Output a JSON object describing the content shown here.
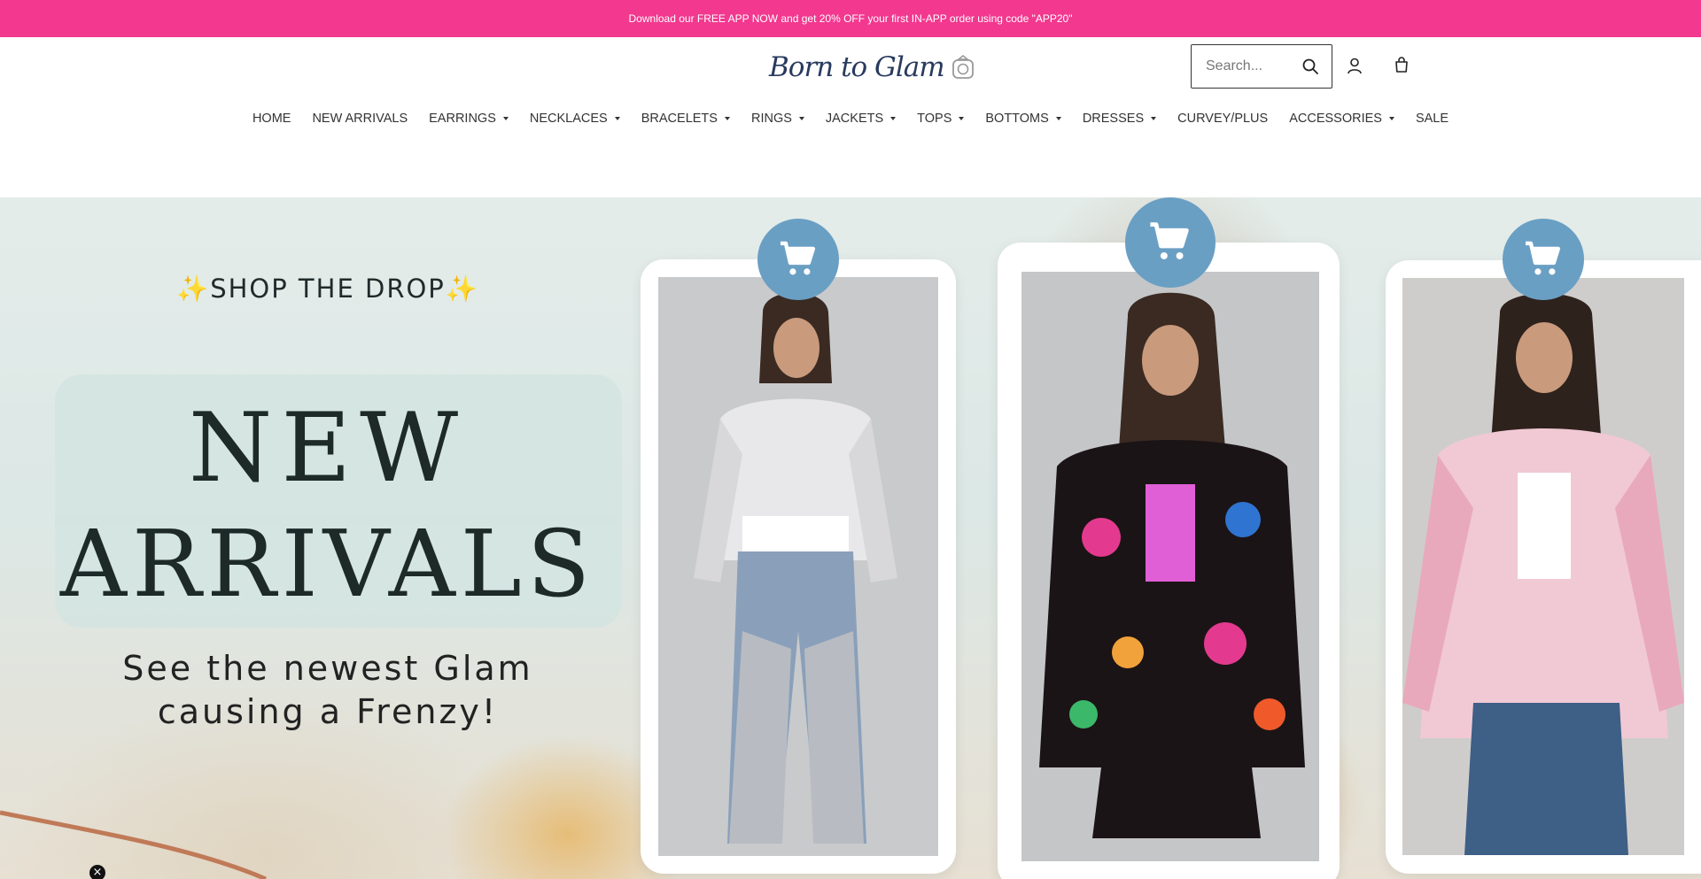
{
  "announcement": "Download our FREE APP NOW and get 20% OFF your first IN-APP order using code \"APP20\"",
  "header": {
    "logo_text": "Born to Glam",
    "search_placeholder": "Search..."
  },
  "nav": [
    {
      "label": "HOME",
      "dropdown": false
    },
    {
      "label": "NEW ARRIVALS",
      "dropdown": false
    },
    {
      "label": "EARRINGS",
      "dropdown": true
    },
    {
      "label": "NECKLACES",
      "dropdown": true
    },
    {
      "label": "BRACELETS",
      "dropdown": true
    },
    {
      "label": "RINGS",
      "dropdown": true
    },
    {
      "label": "JACKETS",
      "dropdown": true
    },
    {
      "label": "TOPS",
      "dropdown": true
    },
    {
      "label": "BOTTOMS",
      "dropdown": true
    },
    {
      "label": "DRESSES",
      "dropdown": true
    },
    {
      "label": "CURVEY/PLUS",
      "dropdown": false
    },
    {
      "label": "ACCESSORIES",
      "dropdown": true
    },
    {
      "label": "SALE",
      "dropdown": false
    }
  ],
  "hero": {
    "eyebrow": "SHOP THE DROP",
    "title_line1": "NEW",
    "title_line2": "ARRIVALS",
    "subtitle_line1": "See the newest Glam",
    "subtitle_line2": "causing a Frenzy!"
  },
  "colors": {
    "announcement_bg": "#f2388f",
    "cart_circle": "#6a9fc4",
    "swoosh": "#c07a58"
  },
  "icons": {
    "search": "search-icon",
    "account": "account-icon",
    "cart": "shopping-bag-icon",
    "product_cart": "shopping-cart-icon"
  }
}
